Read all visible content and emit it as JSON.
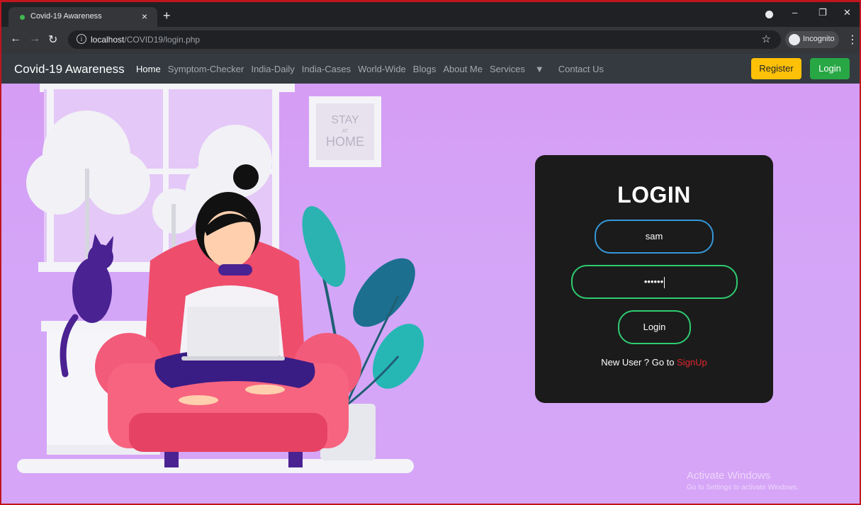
{
  "browser": {
    "tab_title": "Covid-19 Awareness",
    "tab_close": "×",
    "new_tab": "+",
    "url_host": "localhost",
    "url_path": "/COVID19/login.php",
    "incognito_label": "Incognito"
  },
  "navbar": {
    "brand": "Covid-19 Awareness",
    "links": [
      "Home",
      "Symptom-Checker",
      "India-Daily",
      "India-Cases",
      "World-Wide",
      "Blogs",
      "About Me",
      "Services",
      "Contact Us"
    ],
    "register_label": "Register",
    "login_label": "Login",
    "colors": {
      "register": "#ffc107",
      "login": "#28a745",
      "bar": "#343a40"
    }
  },
  "illustration": {
    "poster_line1": "STAY",
    "poster_line2": "AT",
    "poster_line3": "HOME"
  },
  "login_card": {
    "title": "LOGIN",
    "username_value": "sam",
    "password_value": "••••••",
    "submit_label": "Login",
    "signup_prompt": "New User ? Go to ",
    "signup_link": "SignUp",
    "colors": {
      "username_border": "#3498db",
      "password_border": "#2ecc71",
      "link": "#e0262f"
    }
  },
  "watermark": {
    "line1": "Activate Windows",
    "line2": "Go to Settings to activate Windows."
  }
}
